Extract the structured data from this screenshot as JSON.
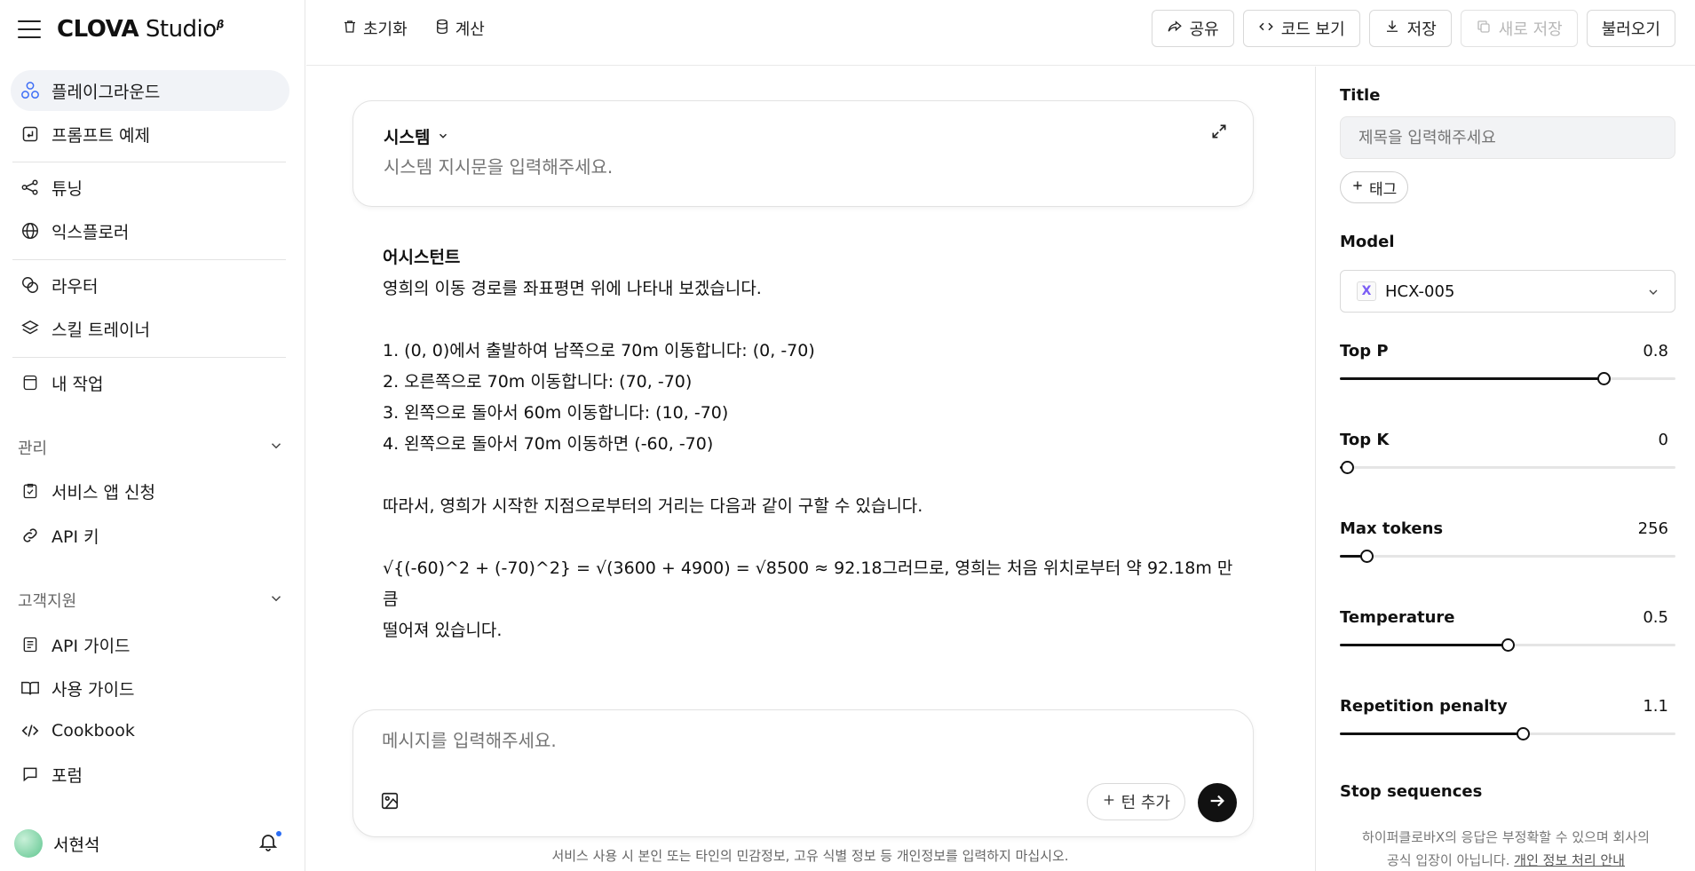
{
  "brand": {
    "name": "CLOVA",
    "studio": " Studio",
    "sup": "β"
  },
  "nav": {
    "playground": "플레이그라운드",
    "prompt_examples": "프롬프트 예제",
    "tuning": "튜닝",
    "explorer": "익스플로러",
    "router": "라우터",
    "skill_trainer": "스킬 트레이너",
    "my_work": "내 작업",
    "manage_section": "관리",
    "service_app": "서비스 앱 신청",
    "api_key": "API 키",
    "support_section": "고객지원",
    "api_guide": "API 가이드",
    "user_guide": "사용 가이드",
    "cookbook": "Cookbook",
    "forum": "포럼"
  },
  "user": {
    "name": "서현석"
  },
  "toolbar": {
    "reset": "초기화",
    "calculate": "계산",
    "share": "공유",
    "view_code": "코드 보기",
    "save": "저장",
    "save_new": "새로 저장",
    "load": "불러오기"
  },
  "system": {
    "title": "시스템",
    "placeholder": "시스템 지시문을 입력해주세요."
  },
  "assistant": {
    "role": "어시스턴트",
    "intro": "영희의 이동 경로를 좌표평면 위에 나타내 보겠습니다.",
    "steps": [
      "1. (0, 0)에서 출발하여 남쪽으로 70m 이동합니다: (0, -70)",
      "2. 오른쪽으로 70m 이동합니다: (70, -70)",
      "3. 왼쪽으로 돌아서 60m 이동합니다: (10, -70)",
      "4. 왼쪽으로 돌아서 70m 이동하면 (-60, -70)"
    ],
    "conclusion": "따라서, 영희가 시작한 지점으로부터의 거리는 다음과 같이 구할 수 있습니다.",
    "formula_line1": "√{(-60)^2 + (-70)^2} = √(3600 + 4900) = √8500 ≈ 92.18그러므로, 영희는 처음 위치로부터 약 92.18m 만큼",
    "formula_line2": "떨어져 있습니다."
  },
  "composer": {
    "placeholder": "메시지를 입력해주세요.",
    "add_turn": "턴 추가"
  },
  "disclaimer": "서비스 사용 시 본인 또는 타인의 민감정보, 고유 식별 정보 등 개인정보를 입력하지 마십시오.",
  "panel": {
    "title_label": "Title",
    "title_placeholder": "제목을 입력해주세요",
    "tag_button": "태그",
    "model_label": "Model",
    "model_value": "HCX-005",
    "model_badge": "X",
    "params": [
      {
        "name": "Top P",
        "value": "0.8",
        "fraction": 0.787
      },
      {
        "name": "Top K",
        "value": "0",
        "fraction": 0.02
      },
      {
        "name": "Max tokens",
        "value": "256",
        "fraction": 0.08
      },
      {
        "name": "Temperature",
        "value": "0.5",
        "fraction": 0.5
      },
      {
        "name": "Repetition penalty",
        "value": "1.1",
        "fraction": 0.545
      }
    ],
    "stop_label": "Stop sequences",
    "footer_line1": "하이퍼클로바X의 응답은 부정확할 수 있으며 회사의",
    "footer_line2": "공식 입장이 아닙니다.",
    "footer_link": "개인 정보 처리 안내"
  },
  "colors": {
    "active_nav_bg": "#f1f3f7",
    "send_button": "#111111",
    "notification_dot": "#2a6df4",
    "model_badge": "#7a5cf5"
  }
}
